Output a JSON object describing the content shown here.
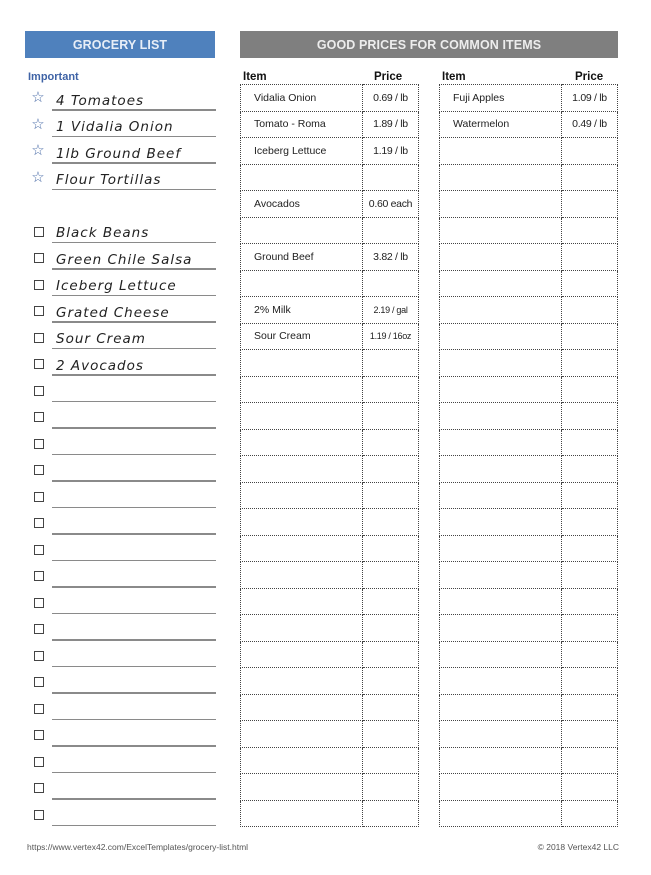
{
  "grocery_list": {
    "title": "GROCERY LIST",
    "important_label": "Important",
    "important_items": [
      {
        "icon": "star-icon",
        "text": "4 Tomatoes"
      },
      {
        "icon": "star-icon",
        "text": "1 Vidalia Onion"
      },
      {
        "icon": "star-icon",
        "text": "1lb Ground Beef"
      },
      {
        "icon": "star-icon",
        "text": "Flour Tortillas"
      }
    ],
    "checklist_items": [
      "Black Beans",
      "Green Chile Salsa",
      "Iceberg Lettuce",
      "Grated Cheese",
      "Sour Cream",
      "2 Avocados",
      "",
      "",
      "",
      "",
      "",
      "",
      "",
      "",
      "",
      "",
      "",
      "",
      "",
      "",
      "",
      "",
      ""
    ]
  },
  "good_prices": {
    "title": "GOOD PRICES FOR COMMON ITEMS",
    "item_header": "Item",
    "price_header": "Price",
    "left_table": [
      {
        "item": "Vidalia Onion",
        "price": "0.69 / lb"
      },
      {
        "item": "Tomato - Roma",
        "price": "1.89 / lb"
      },
      {
        "item": "Iceberg Lettuce",
        "price": "1.19 / lb"
      },
      {
        "item": "",
        "price": ""
      },
      {
        "item": "Avocados",
        "price": "0.60 each"
      },
      {
        "item": "",
        "price": ""
      },
      {
        "item": "Ground Beef",
        "price": "3.82 / lb"
      },
      {
        "item": "",
        "price": ""
      },
      {
        "item": "2% Milk",
        "price": "2.19 / gal"
      },
      {
        "item": "Sour Cream",
        "price": "1.19 / 16oz"
      }
    ],
    "right_table": [
      {
        "item": "Fuji Apples",
        "price": "1.09 / lb"
      },
      {
        "item": "Watermelon",
        "price": "0.49 / lb"
      }
    ],
    "total_rows": 28
  },
  "footer": {
    "url": "https://www.vertex42.com/ExcelTemplates/grocery-list.html",
    "copyright": "© 2018 Vertex42 LLC"
  },
  "colors": {
    "grocery_header": "#4f81bd",
    "prices_header": "#7f7f7f",
    "important_label": "#3f63a6"
  }
}
